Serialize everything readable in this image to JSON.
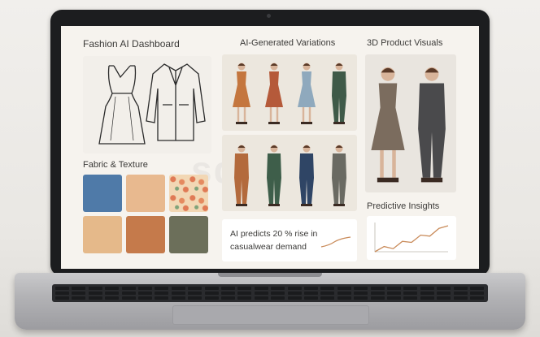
{
  "dashboard": {
    "title": "Fashion AI Dashboard",
    "variations_title": "AI-Generated Variations",
    "visuals_title": "3D Product Visuals",
    "fabric_title": "Fabric & Texture",
    "insights_title": "Predictive Insights",
    "insight_text": "AI predicts 20 % rise in casualwear demand"
  },
  "sketches": [
    {
      "name": "dress-sketch-icon"
    },
    {
      "name": "jacket-sketch-icon"
    }
  ],
  "fabric_swatches": [
    {
      "name": "denim-blue",
      "color": "#4f7aa8"
    },
    {
      "name": "peach",
      "color": "#e8b98f"
    },
    {
      "name": "floral-print",
      "color": "#f2d7b4"
    },
    {
      "name": "sand",
      "color": "#e5b98a"
    },
    {
      "name": "terracotta",
      "color": "#c57a4b"
    },
    {
      "name": "olive",
      "color": "#6c6f5a"
    }
  ],
  "variation_figures": [
    {
      "garment": "dress",
      "color": "#c4763e"
    },
    {
      "garment": "dress",
      "color": "#b55a3a"
    },
    {
      "garment": "dress",
      "color": "#8fa9bd"
    },
    {
      "garment": "suit",
      "color": "#3f5a48"
    },
    {
      "garment": "suit",
      "color": "#b36a3c"
    },
    {
      "garment": "suit",
      "color": "#3e5e4a"
    },
    {
      "garment": "suit",
      "color": "#2f4565"
    },
    {
      "garment": "suit",
      "color": "#6a6a62"
    }
  ],
  "mannequins": [
    {
      "garment": "dress",
      "color": "#7b6c5e"
    },
    {
      "garment": "suit",
      "color": "#4a4a4c"
    }
  ],
  "insight_chart": {
    "type": "line",
    "values": [
      2,
      3,
      2.6,
      4,
      3.8,
      5.2,
      5,
      6.5,
      7
    ]
  }
}
